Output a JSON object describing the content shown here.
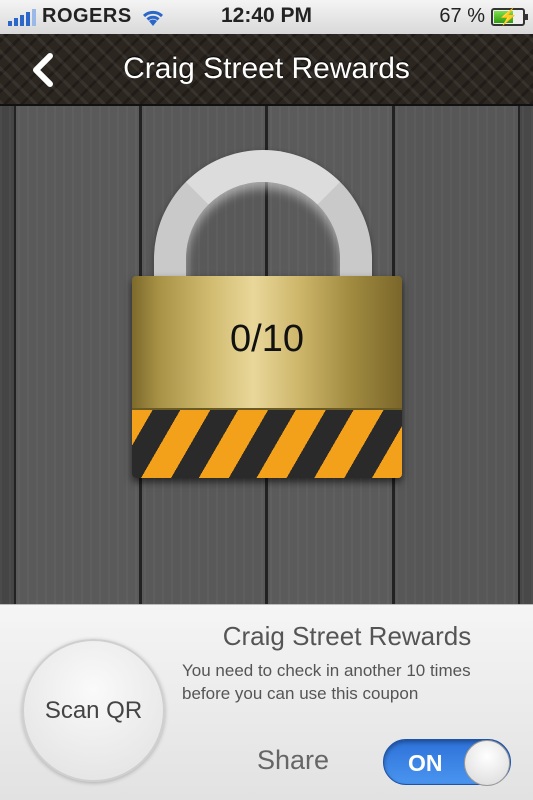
{
  "status_bar": {
    "carrier": "ROGERS",
    "time": "12:40 PM",
    "battery_percent": "67 %",
    "battery_level": 0.67
  },
  "nav": {
    "title": "Craig Street Rewards"
  },
  "lock": {
    "progress": "0/10"
  },
  "panel": {
    "title": "Craig Street Rewards",
    "description": "You need to check in another 10 times before you can use this coupon",
    "scan_label": "Scan QR",
    "share_label": "Share",
    "toggle_label": "ON"
  },
  "colors": {
    "accent_blue": "#2d71d8",
    "hazard_orange": "#f3a11a",
    "gold": "#d2bd72"
  }
}
